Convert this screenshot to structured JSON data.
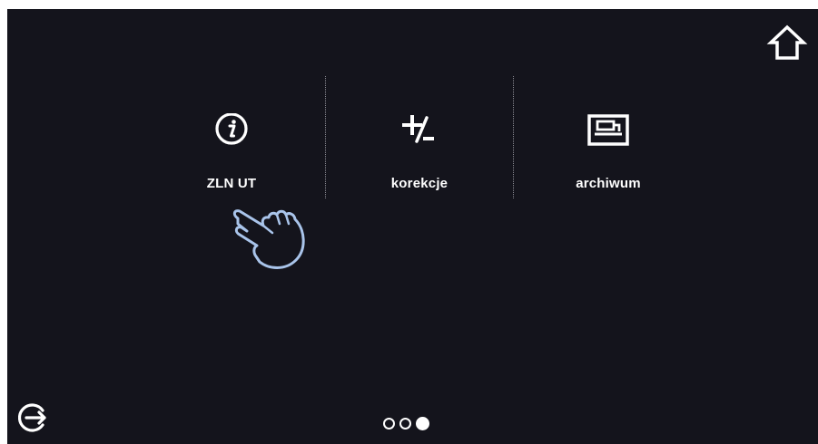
{
  "header": {
    "home_icon": "home-icon"
  },
  "menu": {
    "tiles": [
      {
        "label": "ZLN UT",
        "icon": "info-icon"
      },
      {
        "label": "korekcje",
        "icon": "plus-minus-icon"
      },
      {
        "label": "archiwum",
        "icon": "archive-icon"
      }
    ]
  },
  "overlay": {
    "pointer_icon": "pointing-hand-icon"
  },
  "footer": {
    "exit_icon": "exit-icon",
    "pages": {
      "total": 3,
      "current": 3
    }
  },
  "colors": {
    "background": "#14141c",
    "foreground": "#ffffff",
    "hand_outline": "#a9c4ea"
  }
}
